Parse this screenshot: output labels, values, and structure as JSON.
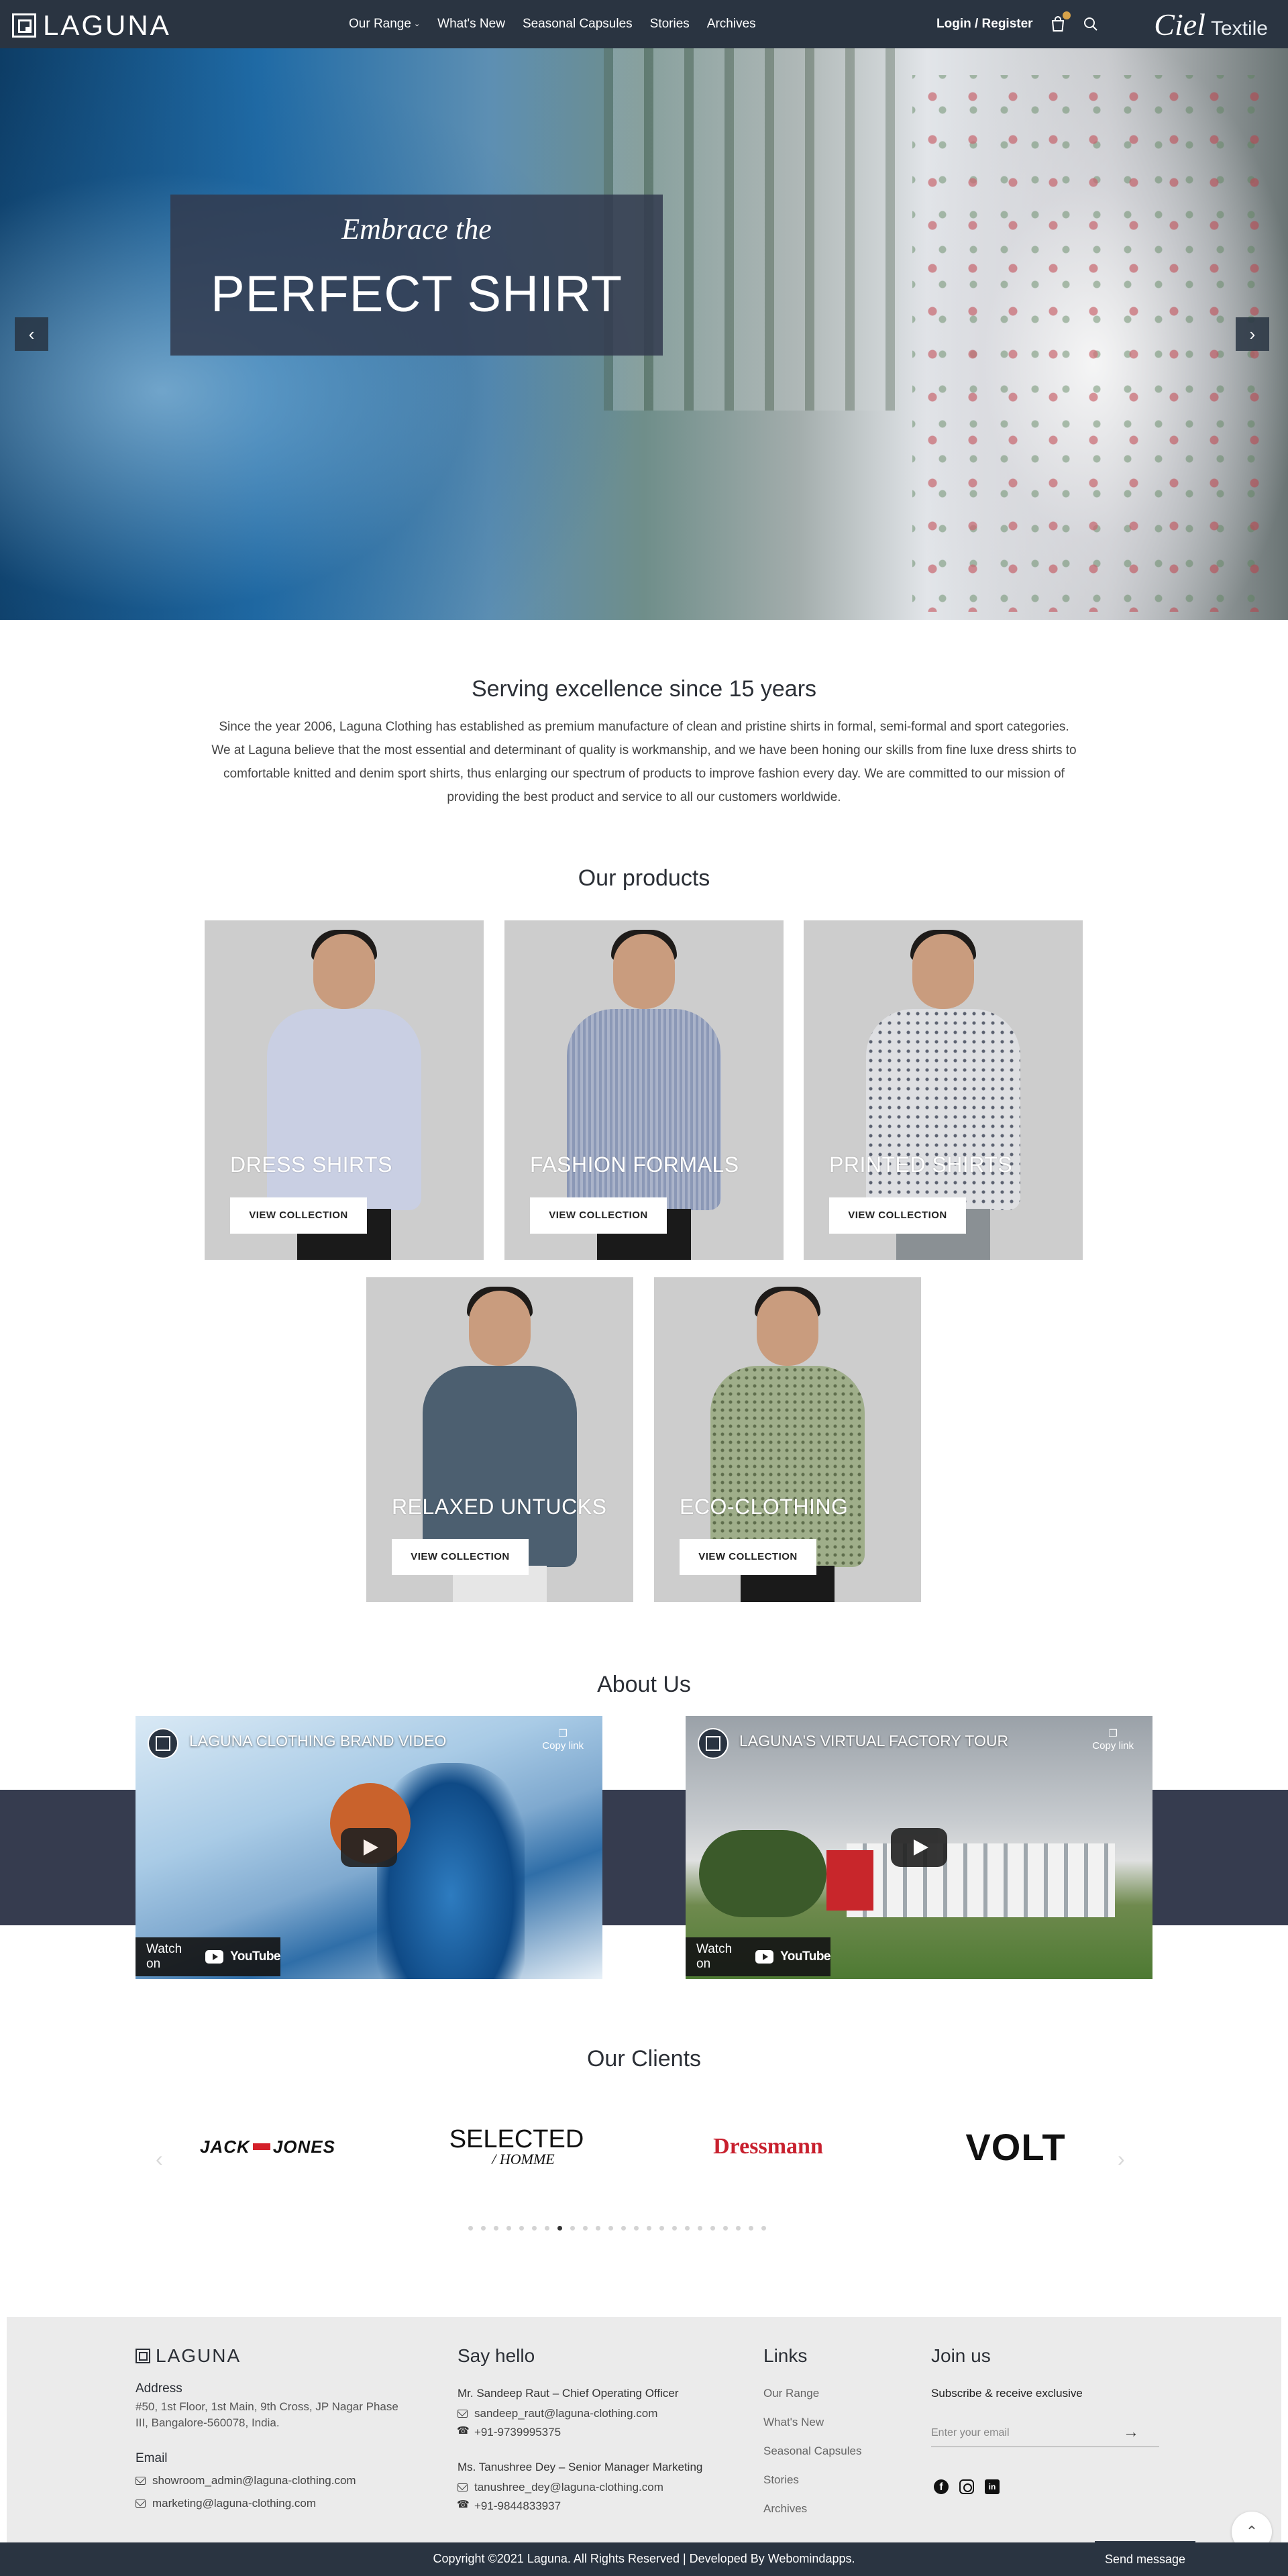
{
  "header": {
    "logo_text": "LAGUNA",
    "nav": [
      {
        "label": "Our Range",
        "has_caret": true
      },
      {
        "label": "What's New"
      },
      {
        "label": "Seasonal Capsules"
      },
      {
        "label": "Stories"
      },
      {
        "label": "Archives"
      }
    ],
    "login_label": "Login / Register",
    "partner_logo_1": "Ciel",
    "partner_logo_2": "Textile"
  },
  "hero": {
    "subtitle": "Embrace the",
    "title": "PERFECT SHIRT",
    "prev_icon": "chevron-left-icon",
    "next_icon": "chevron-right-icon"
  },
  "intro": {
    "title": "Serving excellence since 15 years",
    "text": "Since the year 2006, Laguna Clothing has established as premium manufacture of clean and pristine shirts in formal, semi-formal and sport categories. We at Laguna believe that the most essential and determinant of quality is workmanship, and we have been honing our skills from fine luxe dress shirts to comfortable knitted and denim sport shirts, thus enlarging our spectrum of products to improve fashion every day. We are committed to our mission of providing the best product and service to all our customers worldwide."
  },
  "products": {
    "title": "Our products",
    "items": [
      {
        "name": "DRESS SHIRTS",
        "button": "VIEW COLLECTION",
        "shirt_color": "#c9cfe3"
      },
      {
        "name": "FASHION FORMALS",
        "button": "VIEW COLLECTION",
        "shirt_color": "#8b98b6"
      },
      {
        "name": "PRINTED SHIRTS",
        "button": "VIEW COLLECTION",
        "shirt_color": "#dedfe2"
      },
      {
        "name": "RELAXED UNTUCKS",
        "button": "VIEW COLLECTION",
        "shirt_color": "#4c5f70"
      },
      {
        "name": "ECO-CLOTHING",
        "button": "VIEW COLLECTION",
        "shirt_color": "#9fae8a"
      }
    ]
  },
  "about": {
    "title": "About Us",
    "videos": [
      {
        "title": "LAGUNA CLOTHING BRAND VIDEO",
        "copy_link": "Copy link",
        "watch_label": "Watch on",
        "youtube_label": "YouTube"
      },
      {
        "title": "LAGUNA'S VIRTUAL FACTORY TOUR",
        "copy_link": "Copy link",
        "watch_label": "Watch on",
        "youtube_label": "YouTube"
      }
    ]
  },
  "clients": {
    "title": "Our Clients",
    "logos": {
      "jack_1": "JACK",
      "jack_2": "JONES",
      "selected_1": "SELECTED",
      "selected_2": "/ HOMME",
      "dressmann": "Dressmann",
      "volt": "VOLT"
    },
    "dot_count": 24,
    "active_dot": 7
  },
  "footer": {
    "logo_text": "LAGUNA",
    "address_label": "Address",
    "address_text": "#50, 1st Floor, 1st Main, 9th Cross, JP Nagar Phase III, Bangalore-560078, India.",
    "email_label": "Email",
    "emails": [
      "showroom_admin@laguna-clothing.com",
      "marketing@laguna-clothing.com"
    ],
    "say_hello_title": "Say hello",
    "contacts": [
      {
        "name": "Mr. Sandeep Raut – Chief Operating Officer",
        "email": "sandeep_raut@laguna-clothing.com",
        "phone": "+91-9739995375"
      },
      {
        "name": "Ms. Tanushree Dey – Senior Manager Marketing",
        "email": "tanushree_dey@laguna-clothing.com",
        "phone": "+91-9844833937"
      }
    ],
    "links_title": "Links",
    "links": [
      "Our Range",
      "What's New",
      "Seasonal Capsules",
      "Stories",
      "Archives"
    ],
    "join_title": "Join us",
    "subscribe_text": "Subscribe & receive exclusive",
    "email_placeholder": "Enter your email",
    "social_icons": [
      "facebook-icon",
      "instagram-icon",
      "linkedin-icon"
    ]
  },
  "bottom_bar": {
    "copyright": "Copyright ©2021 Laguna. All Rights Reserved | Developed By Webomindapps.",
    "send_message": "Send message"
  },
  "colors": {
    "header_bg": "#2a3441",
    "about_band": "#363c4f",
    "footer_bg": "#ebebeb",
    "cart_badge": "#d6a24a"
  }
}
